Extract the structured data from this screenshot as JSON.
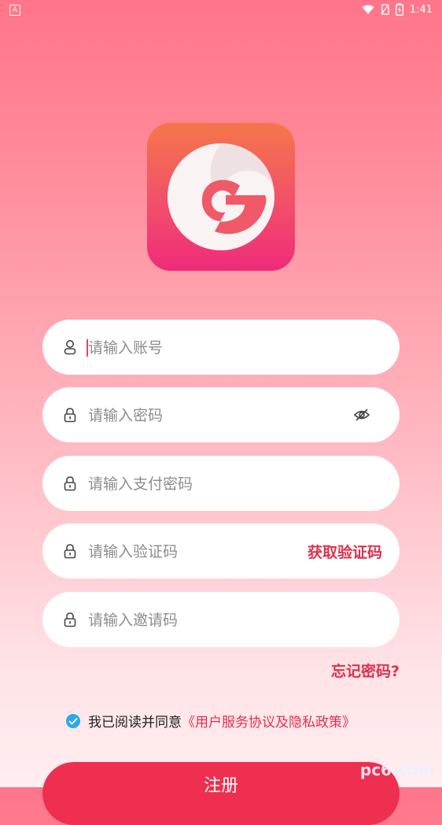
{
  "status_bar": {
    "app_badge": "A",
    "time": "1:41"
  },
  "form": {
    "account": {
      "placeholder": "请输入账号"
    },
    "password": {
      "placeholder": "请输入密码"
    },
    "pay_password": {
      "placeholder": "请输入支付密码"
    },
    "verify_code": {
      "placeholder": "请输入验证码",
      "get_code_label": "获取验证码"
    },
    "invite_code": {
      "placeholder": "请输入邀请码"
    }
  },
  "forgot_label": "忘记密码?",
  "agreement": {
    "prefix": "我已阅读并同意",
    "link": "《用户服务协议及隐私政策》",
    "checked": true
  },
  "register_label": "注册",
  "watermark": "pc6.com",
  "colors": {
    "accent": "#e0304e",
    "button": "#ee2f4f",
    "check": "#2ea7e8"
  }
}
